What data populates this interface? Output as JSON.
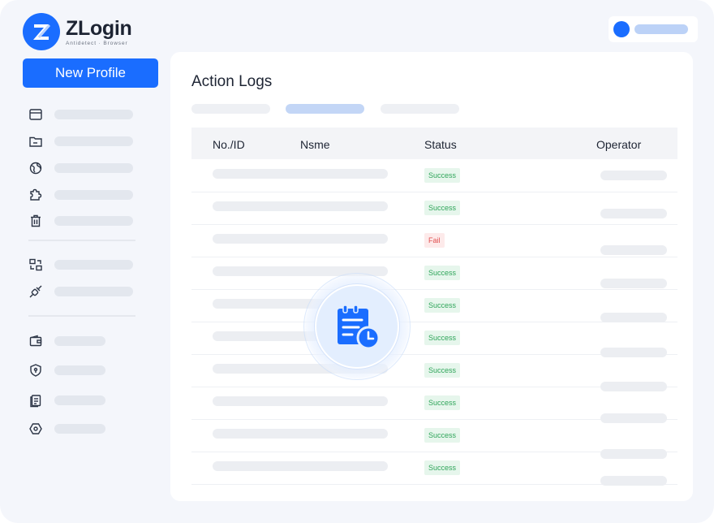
{
  "app": {
    "name": "ZLogin",
    "tagline": "Antidetect · Browser"
  },
  "sidebar": {
    "new_profile_label": "New Profile",
    "items": [
      {
        "icon": "browser-window-icon"
      },
      {
        "icon": "folder-icon"
      },
      {
        "icon": "globe-proxy-icon"
      },
      {
        "icon": "extension-puzzle-icon"
      },
      {
        "icon": "trash-icon"
      },
      {
        "icon": "sync-devices-icon"
      },
      {
        "icon": "api-connector-icon"
      },
      {
        "icon": "wallet-icon"
      },
      {
        "icon": "security-shield-icon"
      },
      {
        "icon": "logs-document-icon"
      },
      {
        "icon": "settings-hex-icon"
      }
    ]
  },
  "main": {
    "title": "Action Logs",
    "table": {
      "columns": [
        "No./ID",
        "Nsme",
        "Status",
        "Operator"
      ],
      "rows": [
        {
          "status": "Success",
          "kind": "ok"
        },
        {
          "status": "Success",
          "kind": "ok"
        },
        {
          "status": "Fail",
          "kind": "fail"
        },
        {
          "status": "Success",
          "kind": "ok"
        },
        {
          "status": "Success",
          "kind": "ok"
        },
        {
          "status": "Success",
          "kind": "ok"
        },
        {
          "status": "Success",
          "kind": "ok"
        },
        {
          "status": "Success",
          "kind": "ok"
        },
        {
          "status": "Success",
          "kind": "ok"
        },
        {
          "status": "Success",
          "kind": "ok"
        }
      ]
    },
    "overlay_icon": "calendar-clock-icon"
  },
  "colors": {
    "accent": "#1a6dff",
    "success_text": "#2fa55a",
    "success_bg": "#e6f6ec",
    "fail_text": "#e04e4e",
    "fail_bg": "#fdeaea"
  }
}
